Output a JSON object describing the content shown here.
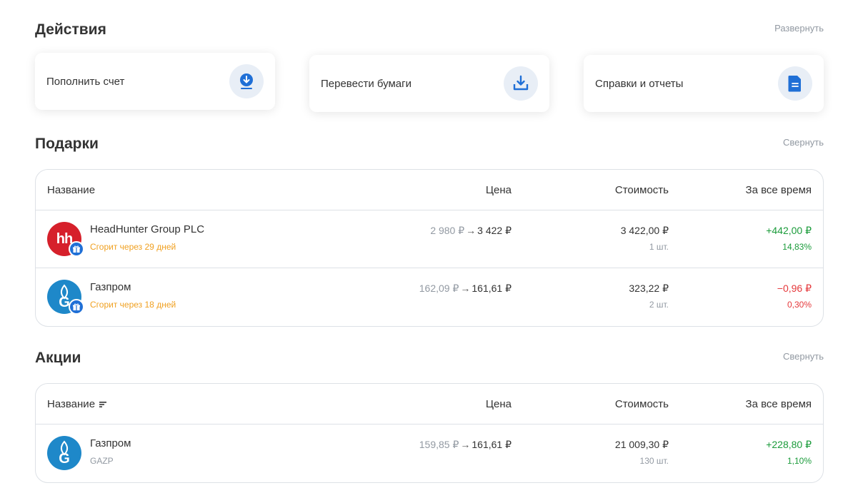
{
  "actions": {
    "title": "Действия",
    "toggle": "Развернуть",
    "cards": [
      {
        "label": "Пополнить счет",
        "icon": "download-circle-icon"
      },
      {
        "label": "Перевести бумаги",
        "icon": "tray-download-icon"
      },
      {
        "label": "Справки и отчеты",
        "icon": "document-icon"
      }
    ]
  },
  "gifts": {
    "title": "Подарки",
    "toggle": "Свернуть",
    "columns": {
      "name": "Название",
      "price": "Цена",
      "cost": "Стоимость",
      "total": "За все время"
    },
    "rows": [
      {
        "name": "HeadHunter Group PLC",
        "sub": "Сгорит через 29 дней",
        "logo_text": "hh",
        "price_old": "2 980 ₽",
        "price_new": "3 422 ₽",
        "cost": "3 422,00 ₽",
        "qty": "1 шт.",
        "total_abs": "+442,00 ₽",
        "total_pct": "14,83%",
        "trend": "positive"
      },
      {
        "name": "Газпром",
        "sub": "Сгорит через 18 дней",
        "logo_text": "G",
        "price_old": "162,09 ₽",
        "price_new": "161,61 ₽",
        "cost": "323,22 ₽",
        "qty": "2 шт.",
        "total_abs": "−0,96 ₽",
        "total_pct": "0,30%",
        "trend": "negative"
      }
    ]
  },
  "stocks": {
    "title": "Акции",
    "toggle": "Свернуть",
    "columns": {
      "name": "Название",
      "price": "Цена",
      "cost": "Стоимость",
      "total": "За все время"
    },
    "rows": [
      {
        "name": "Газпром",
        "sub": "GAZP",
        "logo_text": "G",
        "price_old": "159,85 ₽",
        "price_new": "161,61 ₽",
        "cost": "21 009,30 ₽",
        "qty": "130 шт.",
        "total_abs": "+228,80 ₽",
        "total_pct": "1,10%",
        "trend": "positive"
      }
    ]
  },
  "colors": {
    "accent": "#1f6fd6",
    "positive": "#1a9b3a",
    "negative": "#e5383b",
    "expiry": "#f0a020"
  }
}
